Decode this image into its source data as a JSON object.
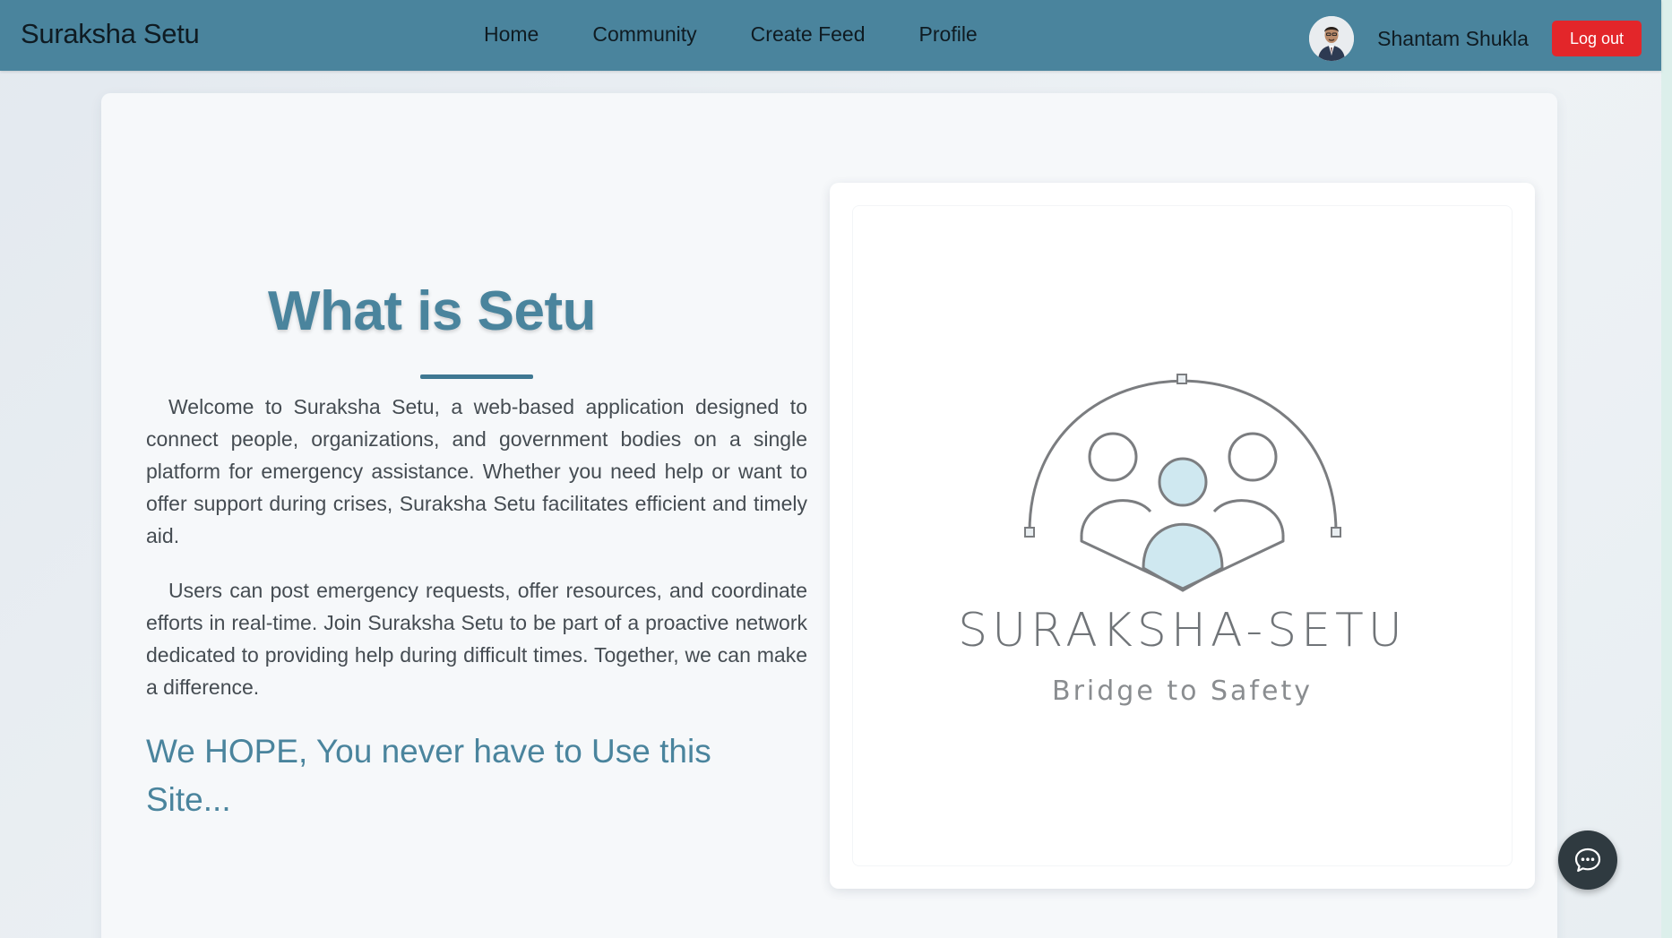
{
  "brand": {
    "name": "Suraksha Setu"
  },
  "nav": {
    "items": [
      {
        "label": "Home"
      },
      {
        "label": "Community"
      },
      {
        "label": "Create Feed"
      },
      {
        "label": "Profile"
      }
    ]
  },
  "user": {
    "name": "Shantam Shukla",
    "avatar_icon": "user-avatar-icon",
    "logout_label": "Log out"
  },
  "main": {
    "heading": "What is Setu",
    "paragraph1": "Welcome to Suraksha Setu, a web-based application designed to connect people, organizations, and government bodies on a single platform for emergency assistance. Whether you need help or want to offer support during crises, Suraksha Setu facilitates efficient and timely aid.",
    "paragraph2": "Users can post emergency requests, offer resources, and coordinate efforts in real-time. Join Suraksha Setu to be part of a proactive network dedicated to providing help during difficult times. Together, we can make a difference.",
    "tagline": "We HOPE, You never have to Use this Site..."
  },
  "logo": {
    "title": "SURAKSHA-SETU",
    "subtitle": "Bridge to Safety",
    "icon": "people-bridge-logo-icon"
  },
  "chat": {
    "icon": "chat-bubble-icon"
  },
  "colors": {
    "navbar": "#4a849d",
    "accent": "#4a849d",
    "logout": "#e3262a",
    "logo_fill": "#cfe8f0"
  }
}
